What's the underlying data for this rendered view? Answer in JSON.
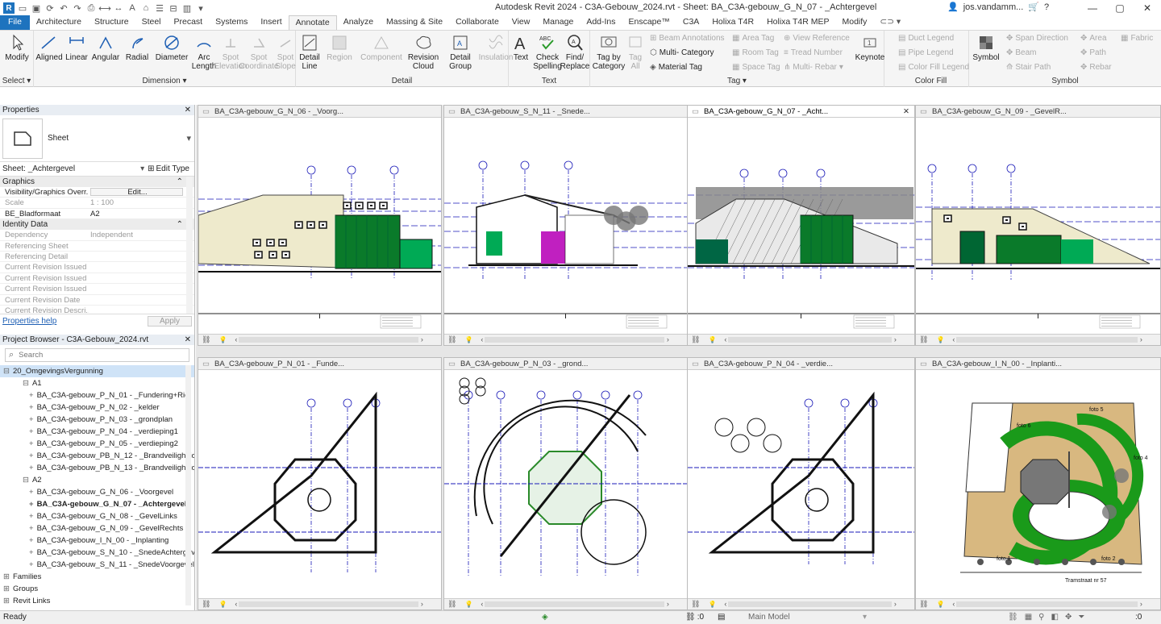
{
  "app": {
    "title": "Autodesk Revit 2024 - C3A-Gebouw_2024.rvt - Sheet: BA_C3A-gebouw_G_N_07 - _Achtergevel",
    "user": "jos.vandamm..."
  },
  "tabs": [
    "File",
    "Architecture",
    "Structure",
    "Steel",
    "Precast",
    "Systems",
    "Insert",
    "Annotate",
    "Analyze",
    "Massing & Site",
    "Collaborate",
    "View",
    "Manage",
    "Add-Ins",
    "Enscape™",
    "C3A",
    "Holixa T4R",
    "Holixa T4R MEP",
    "Modify"
  ],
  "active_tab": "Annotate",
  "ribbon": {
    "select": {
      "modify": "Modify",
      "label": "Select"
    },
    "dimension": {
      "items": [
        "Aligned",
        "Linear",
        "Angular",
        "Radial",
        "Diameter",
        "Arc Length",
        "Spot Elevation",
        "Spot Coordinate",
        "Spot Slope"
      ],
      "label": "Dimension"
    },
    "detail": {
      "items": [
        "Detail Line",
        "Region",
        "Component",
        "Revision Cloud",
        "Detail Group",
        "Insulation"
      ],
      "label": "Detail"
    },
    "text": {
      "items": [
        "Text",
        "Check Spelling",
        "Find/ Replace"
      ],
      "label": "Text"
    },
    "tag": {
      "tag_by_category": "Tag by Category",
      "tag_all": "Tag All",
      "multi_category": "Multi- Category",
      "material_tag": "Material Tag",
      "beam_annotations": "Beam Annotations",
      "area_tag": "Area Tag",
      "room_tag": "Room Tag",
      "space_tag": "Space Tag",
      "view_reference": "View Reference",
      "tread_number": "Tread Number",
      "multi_rebar": "Multi- Rebar",
      "keynote": "Keynote",
      "label": "Tag"
    },
    "color_fill": {
      "duct_legend": "Duct Legend",
      "pipe_legend": "Pipe Legend",
      "color_fill_legend": "Color Fill Legend",
      "label": "Color Fill"
    },
    "symbol": {
      "symbol": "Symbol",
      "span_direction": "Span Direction",
      "beam": "Beam",
      "stair_path": "Stair Path",
      "area": "Area",
      "path": "Path",
      "rebar": "Rebar",
      "fabric": "Fabric",
      "label": "Symbol"
    }
  },
  "properties": {
    "header": "Properties",
    "type_name": "Sheet",
    "selector": "Sheet: _Achtergevel",
    "edit_type": "Edit Type",
    "graphics_section": "Graphics",
    "rows_graphics": [
      {
        "k": "Visibility/Graphics Overr...",
        "v": "Edit..."
      },
      {
        "k": "Scale",
        "v": "1 : 100"
      },
      {
        "k": "BE_Bladformaat",
        "v": "A2"
      }
    ],
    "identity_section": "Identity Data",
    "rows_identity": [
      {
        "k": "Dependency",
        "v": "Independent"
      },
      {
        "k": "Referencing Sheet",
        "v": ""
      },
      {
        "k": "Referencing Detail",
        "v": ""
      },
      {
        "k": "Current Revision Issued",
        "v": ""
      },
      {
        "k": "Current Revision Issued ...",
        "v": ""
      },
      {
        "k": "Current Revision Issued ...",
        "v": ""
      },
      {
        "k": "Current Revision Date",
        "v": ""
      },
      {
        "k": "Current Revision Descri...",
        "v": ""
      }
    ],
    "help": "Properties help",
    "apply": "Apply"
  },
  "browser": {
    "header": "Project Browser - C3A-Gebouw_2024.rvt",
    "search_placeholder": "Search",
    "group": "20_OmgevingsVergunning",
    "sub_a1": "A1",
    "a1_items": [
      "BA_C3A-gebouw_P_N_01 - _Fundering+Riol",
      "BA_C3A-gebouw_P_N_02 - _kelder",
      "BA_C3A-gebouw_P_N_03 - _grondplan",
      "BA_C3A-gebouw_P_N_04 - _verdieping1",
      "BA_C3A-gebouw_P_N_05 - _verdieping2",
      "BA_C3A-gebouw_PB_N_12 - _Brandveiligheid",
      "BA_C3A-gebouw_PB_N_13 - _Brandveiligheid"
    ],
    "sub_a2": "A2",
    "a2_items": [
      "BA_C3A-gebouw_G_N_06 - _Voorgevel",
      "BA_C3A-gebouw_G_N_07 - _Achtergevel",
      "BA_C3A-gebouw_G_N_08 - _GevelLinks",
      "BA_C3A-gebouw_G_N_09 - _GevelRechts",
      "BA_C3A-gebouw_I_N_00 - _Inplanting",
      "BA_C3A-gebouw_S_N_10 - _SnedeAchtergev",
      "BA_C3A-gebouw_S_N_11 - _SnedeVoorgevel"
    ],
    "roots": [
      "Families",
      "Groups",
      "Revit Links"
    ]
  },
  "views": [
    {
      "title": "BA_C3A-gebouw_G_N_06 - _Voorg...",
      "kind": "elev1"
    },
    {
      "title": "BA_C3A-gebouw_S_N_11 - _Snede...",
      "kind": "section"
    },
    {
      "title": "BA_C3A-gebouw_G_N_07 - _Acht...",
      "kind": "elev2",
      "active": true
    },
    {
      "title": "BA_C3A-gebouw_G_N_09 - _GevelR...",
      "kind": "elev3"
    },
    {
      "title": "BA_C3A-gebouw_P_N_01 - _Funde...",
      "kind": "plan1"
    },
    {
      "title": "BA_C3A-gebouw_P_N_03 - _grond...",
      "kind": "plan2"
    },
    {
      "title": "BA_C3A-gebouw_P_N_04 - _verdie...",
      "kind": "plan3"
    },
    {
      "title": "BA_C3A-gebouw_I_N_00 - _Inplanti...",
      "kind": "site"
    }
  ],
  "site_labels": {
    "foto1": "foto 1",
    "foto2": "foto 2",
    "foto4": "foto 4",
    "foto5": "foto 5",
    "foto6": "foto 6",
    "street": "Tramstraat nr 57"
  },
  "status": {
    "text": "Ready",
    "coord": ":0",
    "model": "Main Model",
    "filter": ":0"
  },
  "colors": {
    "accent": "#1e73be",
    "grid_blue": "#1a1ab8",
    "glass_green": "#0a7a2a",
    "magenta": "#c020c0",
    "sand": "#eeeacc"
  }
}
